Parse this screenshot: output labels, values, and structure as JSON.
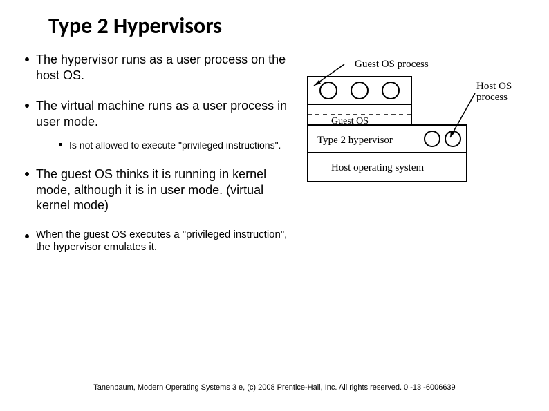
{
  "title": "Type 2 Hypervisors",
  "bullets": {
    "b1": "The hypervisor runs as a user process on the host OS.",
    "b2": "The virtual machine runs as a user process in user mode.",
    "b2sub": "Is not allowed to execute \"privileged instructions\".",
    "b3": "The guest OS thinks it is running in kernel mode, although it is in user mode. (virtual kernel mode)",
    "b4": "When the guest OS executes a \"privileged instruction\", the hypervisor emulates it."
  },
  "diagram": {
    "label_guest_process": "Guest OS process",
    "label_host_process": "Host OS process",
    "label_guest_os": "Guest OS",
    "label_hypervisor": "Type 2 hypervisor",
    "label_host_os": "Host operating system"
  },
  "footer": "Tanenbaum, Modern Operating Systems 3 e, (c) 2008 Prentice-Hall, Inc. All rights reserved. 0 -13 -6006639"
}
